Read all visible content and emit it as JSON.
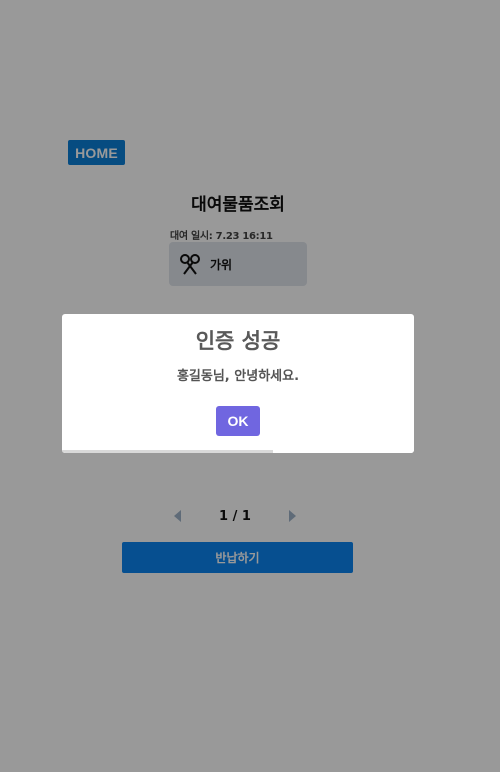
{
  "header": {
    "home_label": "HOME"
  },
  "page": {
    "title": "대여물품조회",
    "rental_date": "대여 일시: 7.23 16:11",
    "items": [
      {
        "name": "가위",
        "icon": "scissors-icon"
      }
    ],
    "pagination": {
      "text": "1 / 1"
    },
    "return_label": "반납하기"
  },
  "modal": {
    "title": "인증 성공",
    "message": "홍길동님, 안녕하세요.",
    "ok_label": "OK",
    "timer_progress": 0.6
  },
  "colors": {
    "home_button": "#0a7fd8",
    "return_button": "#0a84f0",
    "ok_button": "#7066e0",
    "overlay": "rgba(0,0,0,0.4)"
  }
}
